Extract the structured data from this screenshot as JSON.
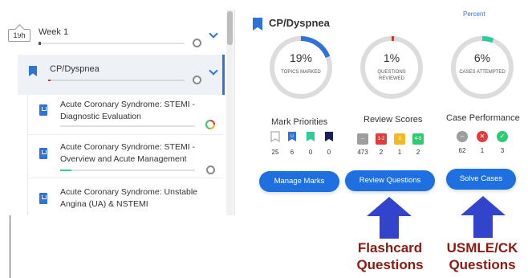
{
  "left": {
    "week": {
      "badge": "19h",
      "title": "Week 1"
    },
    "topic": {
      "title": "CP/Dyspnea"
    },
    "sub_items": [
      {
        "title_line1": "Acute Coronary Syndrome: STEMI -",
        "title_line2": "Diagnostic Evaluation"
      },
      {
        "title_line1": "Acute Coronary Syndrome: STEMI -",
        "title_line2": "Overview and Acute Management"
      },
      {
        "title_line1": "Acute Coronary Syndrome: Unstable",
        "title_line2": "Angina (UA) & NSTEMI"
      }
    ]
  },
  "right": {
    "title": "CP/Dyspnea",
    "percent_link": "Percent",
    "donuts": [
      {
        "value": "19%",
        "label": "TOPICS MARKED",
        "fraction": 0.19,
        "accent": "#2f73d6"
      },
      {
        "value": "1%",
        "label": "QUESTIONS REVIEWED",
        "fraction": 0.01,
        "accent": "#c0392b"
      },
      {
        "value": "6%",
        "label": "CASES ATTEMPTED",
        "fraction": 0.06,
        "accent": "#2ecc9a"
      }
    ],
    "mark_priorities": {
      "title": "Mark Priorities",
      "items": [
        {
          "icon": "bookmark-outline-icon",
          "count": "25"
        },
        {
          "icon": "bookmark-blue-u-icon",
          "count": "6"
        },
        {
          "icon": "bookmark-teal-icon",
          "count": "0"
        },
        {
          "icon": "bookmark-navy-icon",
          "count": "0"
        }
      ]
    },
    "review_scores": {
      "title": "Review Scores",
      "items": [
        {
          "badge": "–",
          "count": "473",
          "color": "#9e9e9e"
        },
        {
          "badge": "1-2",
          "count": "2",
          "color": "#e03c3c"
        },
        {
          "badge": "3",
          "count": "1",
          "color": "#f2b922"
        },
        {
          "badge": "4-5",
          "count": "2",
          "color": "#2ecc71"
        }
      ]
    },
    "case_performance": {
      "title": "Case Performance",
      "items": [
        {
          "badge": "–",
          "count": "62",
          "color": "#9e9e9e"
        },
        {
          "badge": "✕",
          "count": "1",
          "color": "#e03c3c"
        },
        {
          "badge": "✓",
          "count": "3",
          "color": "#2ecc71"
        }
      ]
    },
    "buttons": {
      "manage": "Manage Marks",
      "review": "Review Questions",
      "solve": "Solve Cases"
    }
  },
  "annotations": {
    "flashcard": [
      "Flashcard",
      "Questions"
    ],
    "usmle": [
      "USMLE/CK",
      "Questions"
    ]
  },
  "colors": {
    "primary": "#1e6fe0",
    "annotation": "#8b1a12",
    "arrow": "#3344cc"
  }
}
